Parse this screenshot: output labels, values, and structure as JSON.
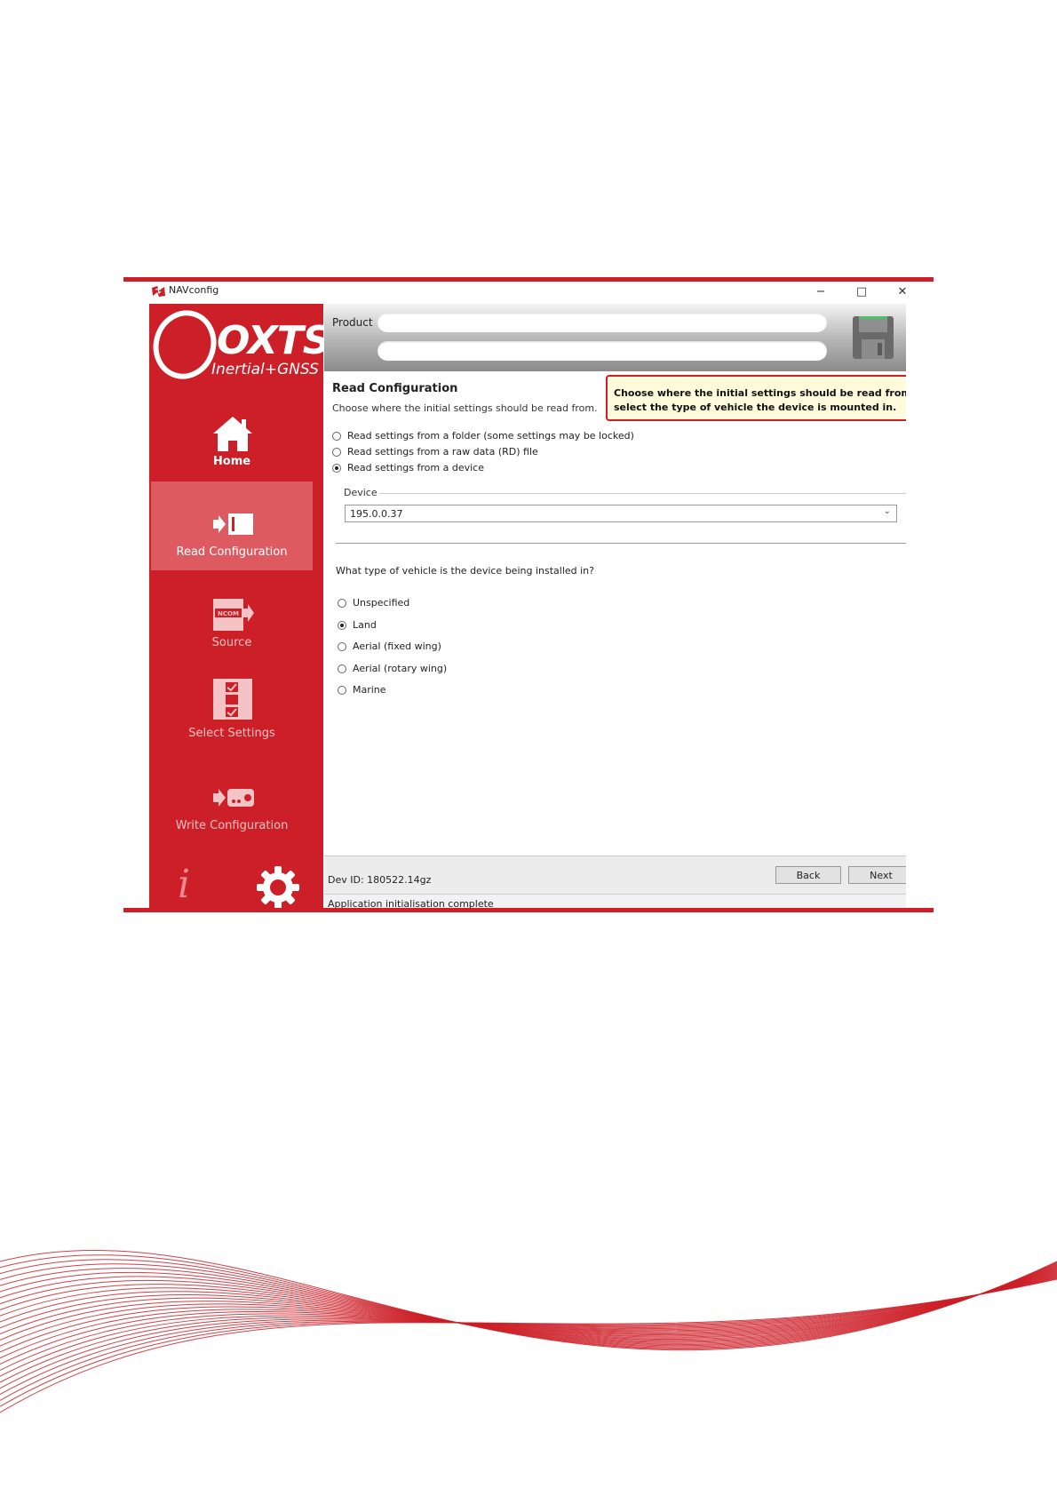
{
  "window": {
    "title": "NAVconfig",
    "controls": {
      "minimize": "−",
      "maximize": "□",
      "close": "✕"
    }
  },
  "brand": {
    "logo": "OXTS",
    "tagline": "Inertial+GNSS",
    "color": "#cc1f27"
  },
  "sidebar": {
    "items": [
      {
        "label": "Home",
        "icon": "home-icon",
        "state": "normal"
      },
      {
        "label": "Read Configuration",
        "icon": "read-config-icon",
        "state": "active"
      },
      {
        "label": "Source",
        "icon": "ncom-source-icon",
        "state": "disabled"
      },
      {
        "label": "Select Settings",
        "icon": "checklist-icon",
        "state": "disabled"
      },
      {
        "label": "Write Configuration",
        "icon": "write-config-icon",
        "state": "disabled"
      }
    ],
    "ncom_badge": "NCOM",
    "footer_icons": [
      "info-icon",
      "gear-icon"
    ]
  },
  "header": {
    "product_label": "Product",
    "product_value": "",
    "second_value": "",
    "save_icon": "floppy-disk-icon"
  },
  "content": {
    "title": "Read Configuration",
    "subtitle": "Choose where the initial settings should be read from.",
    "hint_line1": "Choose where the initial settings should be read from ar",
    "hint_line2": "select the type of vehicle the device is mounted in.",
    "source_options": [
      {
        "label": "Read settings from a folder (some settings may be locked)",
        "selected": false
      },
      {
        "label": "Read settings from a raw data (RD) file",
        "selected": false
      },
      {
        "label": "Read settings from a device",
        "selected": true
      }
    ],
    "device_legend": "Device",
    "device_value": "195.0.0.37",
    "vehicle_question": "What type of vehicle is the device being installed in?",
    "vehicle_options": [
      {
        "label": "Unspecified",
        "selected": false
      },
      {
        "label": "Land",
        "selected": true
      },
      {
        "label": "Aerial (fixed wing)",
        "selected": false
      },
      {
        "label": "Aerial (rotary wing)",
        "selected": false
      },
      {
        "label": "Marine",
        "selected": false
      }
    ]
  },
  "footer": {
    "dev_id": "Dev ID: 180522.14gz",
    "back_label": "Back",
    "next_label": "Next",
    "status_text": "Application initialisation complete"
  }
}
